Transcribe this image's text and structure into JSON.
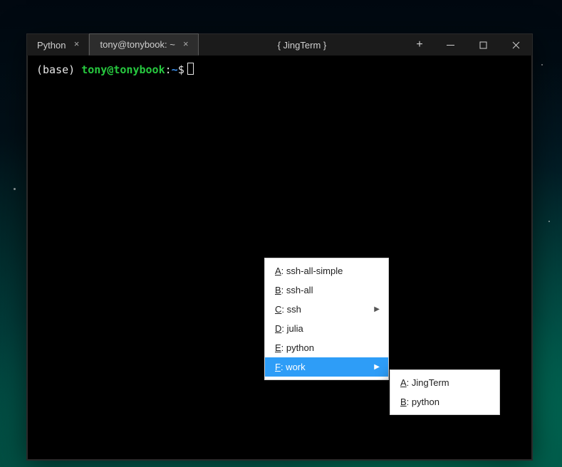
{
  "titlebar": {
    "tabs": [
      {
        "label": "Python",
        "active": false
      },
      {
        "label": "tony@tonybook: ~",
        "active": true
      }
    ],
    "app_title": "{ JingTerm }"
  },
  "window_controls": {
    "new_tab": "+",
    "minimize": "minimize-icon",
    "maximize": "maximize-icon",
    "close": "close-icon"
  },
  "prompt": {
    "env": "(base)",
    "user_host": "tony@tonybook",
    "separator": ":",
    "path": "~",
    "symbol": "$"
  },
  "context_menu": {
    "items": [
      {
        "hotkey": "A",
        "label": ": ssh-all-simple",
        "submenu": false,
        "highlight": false
      },
      {
        "hotkey": "B",
        "label": ": ssh-all",
        "submenu": false,
        "highlight": false
      },
      {
        "hotkey": "C",
        "label": ": ssh",
        "submenu": true,
        "highlight": false
      },
      {
        "hotkey": "D",
        "label": ": julia",
        "submenu": false,
        "highlight": false
      },
      {
        "hotkey": "E",
        "label": ": python",
        "submenu": false,
        "highlight": false
      },
      {
        "hotkey": "F",
        "label": ": work",
        "submenu": true,
        "highlight": true
      }
    ],
    "submenu": [
      {
        "hotkey": "A",
        "label": ": JingTerm"
      },
      {
        "hotkey": "B",
        "label": ": python"
      }
    ]
  }
}
